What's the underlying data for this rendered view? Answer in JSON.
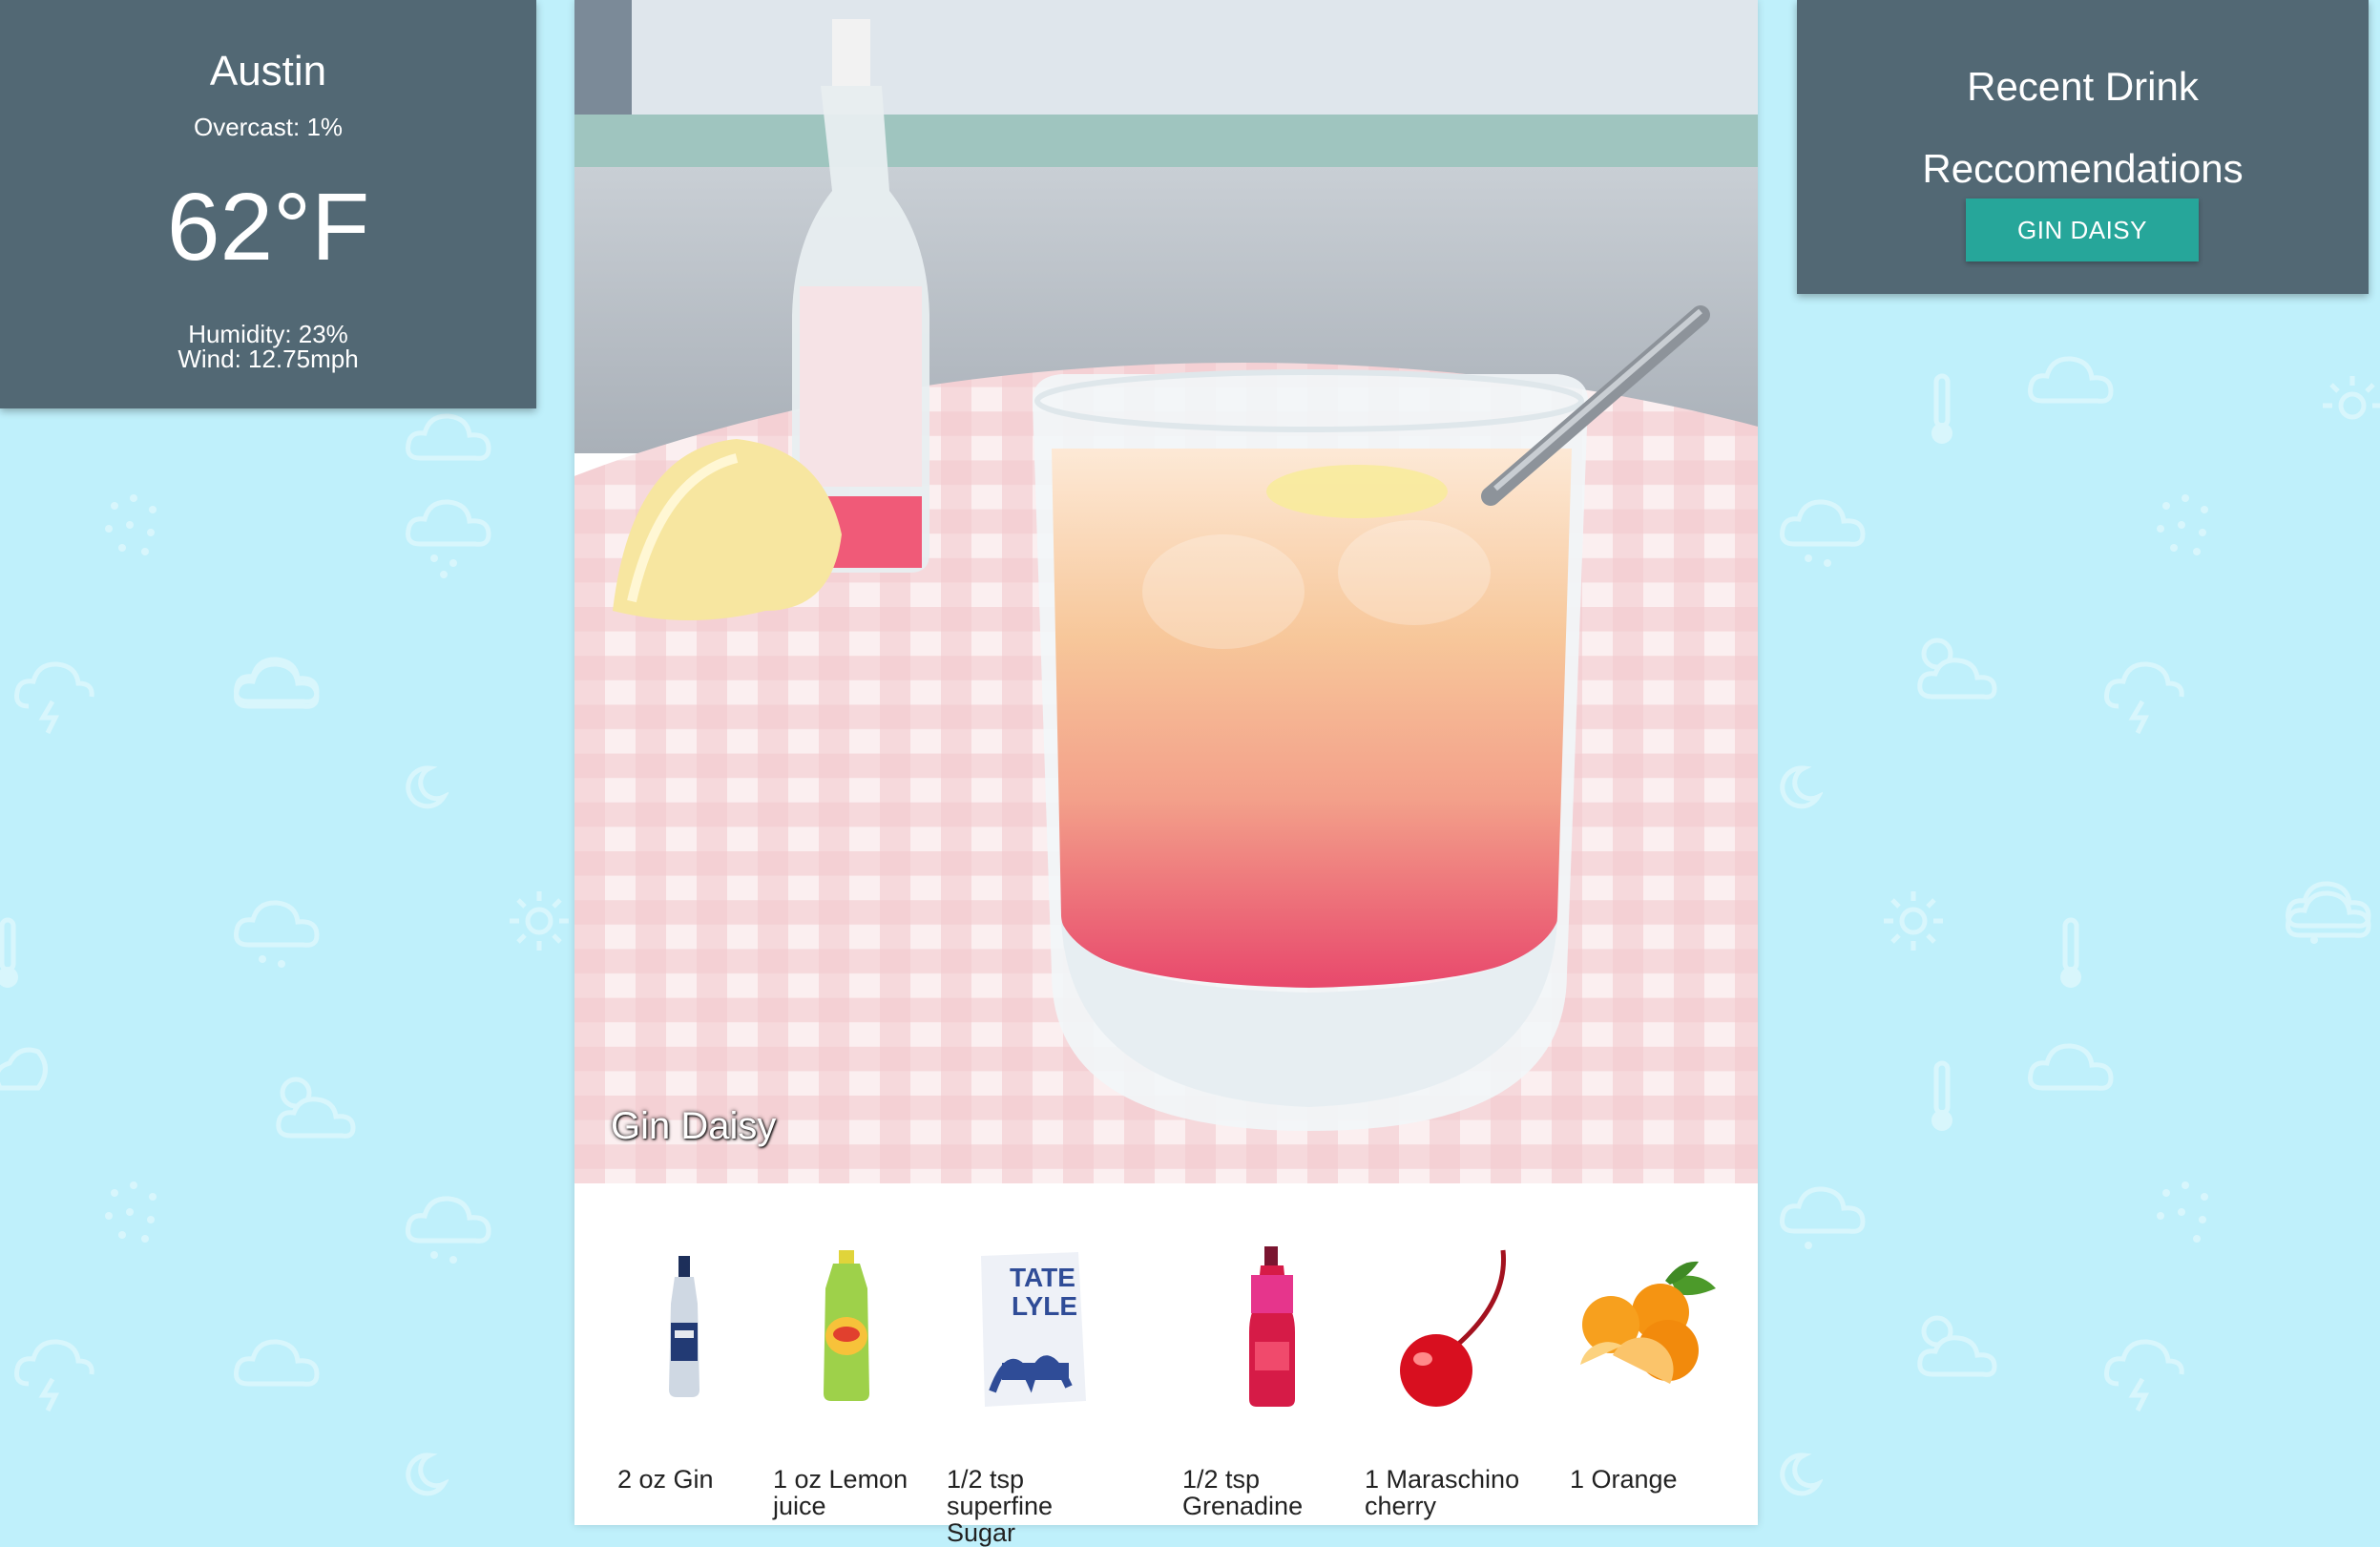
{
  "weather": {
    "city": "Austin",
    "overcast": "Overcast: 1%",
    "temperature": "62°F",
    "humidity": "Humidity: 23%",
    "wind": "Wind: 12.75mph"
  },
  "recent": {
    "title_line1": "Recent Drink",
    "title_line2": "Reccomendations",
    "drinks": [
      "GIN DAISY"
    ]
  },
  "drink": {
    "name": "Gin Daisy",
    "ingredients": [
      {
        "label_line1": "2 oz Gin",
        "label_line2": "",
        "icon": "gin-bottle-icon"
      },
      {
        "label_line1": "1 oz Lemon",
        "label_line2": "juice",
        "icon": "lemon-juice-bottle-icon"
      },
      {
        "label_line1": "1/2 tsp superfine",
        "label_line2": "Sugar",
        "icon": "sugar-bag-icon"
      },
      {
        "label_line1": "1/2 tsp",
        "label_line2": "Grenadine",
        "icon": "grenadine-bottle-icon"
      },
      {
        "label_line1": "1 Maraschino",
        "label_line2": "cherry",
        "icon": "cherry-icon"
      },
      {
        "label_line1": "1 Orange",
        "label_line2": "",
        "icon": "orange-icon"
      }
    ]
  },
  "colors": {
    "background": "#bff0fb",
    "card": "#526874",
    "button": "#26a69a"
  }
}
